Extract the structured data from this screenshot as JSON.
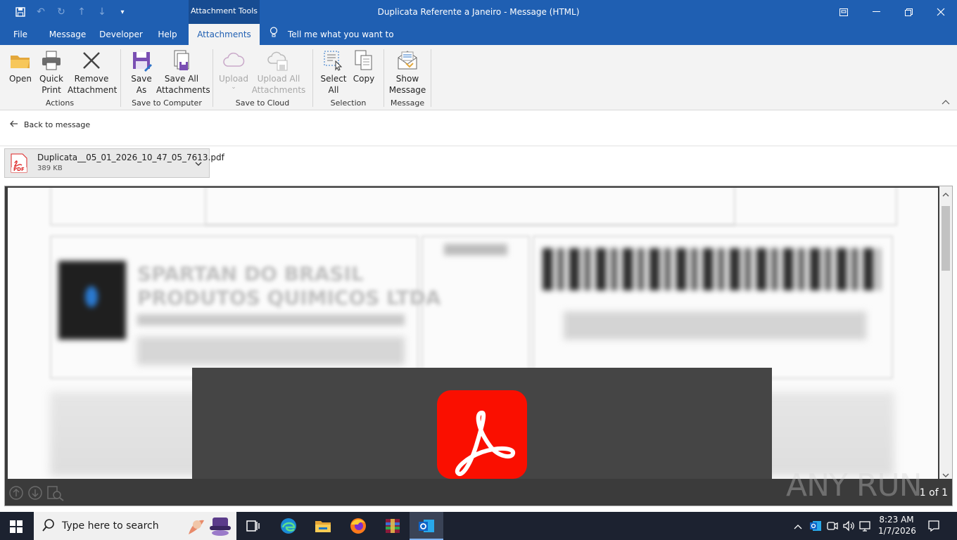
{
  "titlebar": {
    "context_tab": "Attachment Tools",
    "window_title": "Duplicata Referente a Janeiro  -  Message (HTML)"
  },
  "tabs": [
    {
      "label": "File"
    },
    {
      "label": "Message"
    },
    {
      "label": "Developer"
    },
    {
      "label": "Help"
    },
    {
      "label": "Attachments"
    }
  ],
  "tell_me": "Tell me what you want to do",
  "ribbon": {
    "open": "Open",
    "quick_print": [
      "Quick",
      "Print"
    ],
    "remove_attachment": [
      "Remove",
      "Attachment"
    ],
    "save_as": [
      "Save",
      "As"
    ],
    "save_all": [
      "Save All",
      "Attachments"
    ],
    "upload": "Upload",
    "upload_all": [
      "Upload All",
      "Attachments"
    ],
    "select_all": [
      "Select",
      "All"
    ],
    "copy": "Copy",
    "show_message": [
      "Show",
      "Message"
    ],
    "groups": {
      "actions": "Actions",
      "save_to_computer": "Save to Computer",
      "save_to_cloud": "Save to Cloud",
      "selection": "Selection",
      "message": "Message"
    }
  },
  "back_to_message": "Back to message",
  "attachment": {
    "name": "Duplicata__05_01_2026_10_47_05_7613.pdf",
    "size": "389 KB",
    "icon_label": "PDF"
  },
  "preview": {
    "company_blur": [
      "SPARTAN DO BRASIL",
      "PRODUTOS QUIMICOS LTDA"
    ],
    "page_indicator": "1 of 1",
    "watermark": "ANY RUN"
  },
  "taskbar": {
    "search_placeholder": "Type here to search",
    "time": "8:23 AM",
    "date": "1/7/2026"
  },
  "colors": {
    "accent": "#1f5fb2",
    "acrobat_red": "#fa0f00"
  }
}
